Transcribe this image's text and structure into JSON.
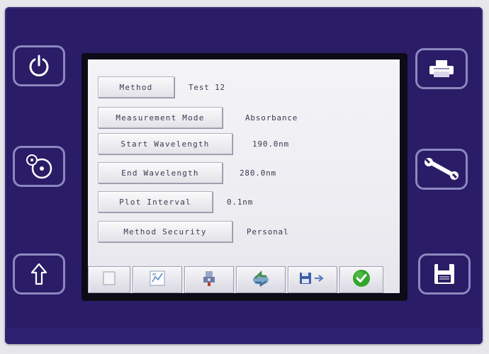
{
  "screen": {
    "rows": [
      {
        "label": "Method",
        "value": "Test 12"
      },
      {
        "label": "Measurement Mode",
        "value": "Absorbance"
      },
      {
        "label": "Start Wavelength",
        "value": "190.0nm"
      },
      {
        "label": "End Wavelength",
        "value": "280.0nm"
      },
      {
        "label": "Plot Interval",
        "value": "0.1nm"
      },
      {
        "label": "Method Security",
        "value": "Personal"
      }
    ],
    "tabs": [
      "blank-tab-icon",
      "settings-grid-icon",
      "scan-sample-icon",
      "recycle-icon",
      "save-to-icon",
      "check-confirm-icon"
    ]
  },
  "hardware_buttons": {
    "left": [
      "power-icon",
      "disc-icon",
      "upload-arrow-icon"
    ],
    "right": [
      "printer-icon",
      "wrench-icon",
      "floppy-disk-icon"
    ]
  },
  "colors": {
    "bezel": "#2a1c66",
    "button_outline": "#8b88bf",
    "screen": "#f1f0f4",
    "check": "#34a52c"
  }
}
